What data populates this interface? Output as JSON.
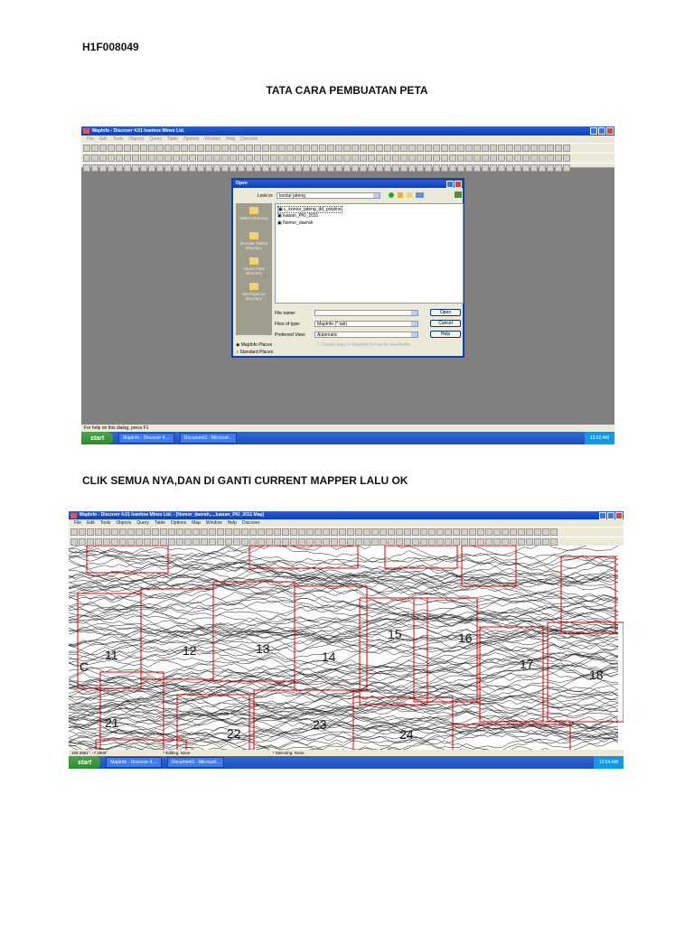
{
  "doc": {
    "code": "H1F008049",
    "title": "TATA CARA PEMBUATAN PETA",
    "caption": "CLIK SEMUA NYA,DAN DI GANTI CURRENT MAPPER LALU OK"
  },
  "shot1": {
    "title": "MapInfo - Discover 4.01    Ivanhoe Mines Ltd.",
    "menu": [
      "File",
      "Edit",
      "Tools",
      "Objects",
      "Query",
      "Table",
      "Options",
      "Window",
      "Help",
      "Discover"
    ],
    "status": "For help on this dialog, press F1",
    "taskbar": {
      "start": "start",
      "tasks": [
        "MapInfo - Discover 4....",
        "Document1 - Microsof..."
      ],
      "clock": "12:02 AM"
    },
    "dialog": {
      "title": "Open",
      "look_in_label": "Look in:",
      "look_in_value": "kontur jateng",
      "places": [
        "Tables Directory",
        "Remote Tables Directory",
        "Import Files Directory",
        "Workspaces Directory"
      ],
      "files": [
        "c_kontur_jateng_dd_polyline",
        "luasan_PKI_2011",
        "Nomor_daerah"
      ],
      "file_name_label": "File name:",
      "file_name_value": "",
      "files_of_type_label": "Files of type:",
      "files_of_type_value": "MapInfo (*.tab)",
      "preferred_view_label": "Preferred View:",
      "preferred_view_value": "Automatic",
      "copy_checkbox": "Create copy in MapInfo format for read/write",
      "open": "Open",
      "cancel": "Cancel",
      "help": "Help",
      "radio_mapinfo": "MapInfo Places",
      "radio_standard": "Standard Places"
    }
  },
  "shot2": {
    "title": "MapInfo - Discover 4.01    Ivanhoe Mines Ltd. - [Nomor_daerah,...,luasan_PKI_2011 Map]",
    "menu": [
      "File",
      "Edit",
      "Tools",
      "Objects",
      "Query",
      "Table",
      "Options",
      "Map",
      "Window",
      "Help",
      "Discover"
    ],
    "status": [
      "109.3961°, -7.2509°",
      "* Editing: None",
      "* Selecting: None"
    ],
    "taskbar": {
      "start": "start",
      "tasks": [
        "MapInfo - Discover 4....",
        "Document1 - Microsof..."
      ],
      "clock": "12:54 AM"
    },
    "map_labels": [
      "C",
      "11",
      "12",
      "13",
      "14",
      "15",
      "16",
      "17",
      "18",
      "21",
      "22",
      "23",
      "24"
    ]
  },
  "colors": {
    "grid_red": "#e00000",
    "title_blue": "#0a3fb8"
  }
}
